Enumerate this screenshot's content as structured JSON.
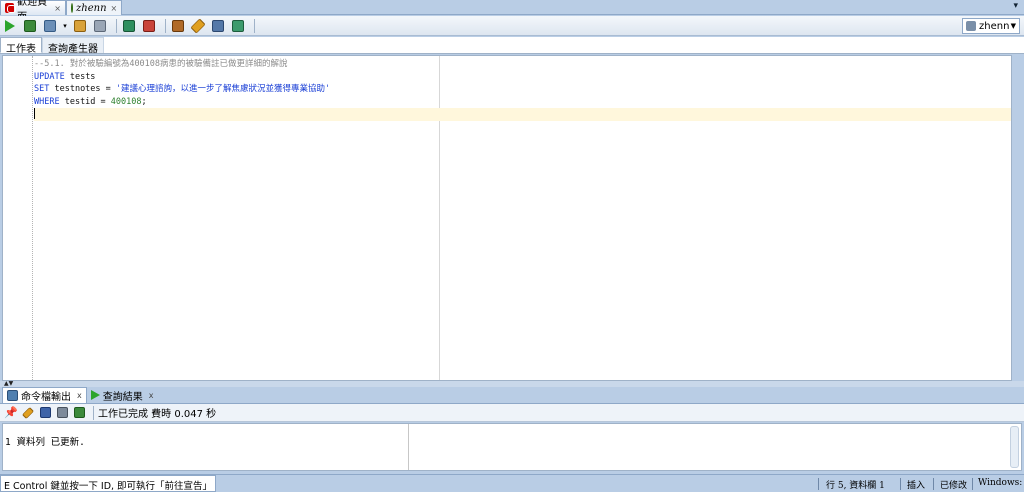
{
  "doc_tabs": [
    {
      "label": "歡迎頁面",
      "close": "×"
    },
    {
      "label": "zhenn",
      "close": "×"
    }
  ],
  "window_menu": "▾",
  "connection": {
    "name": "zhenn"
  },
  "worksheet_tabs": [
    {
      "label": "工作表",
      "active": true
    },
    {
      "label": "查詢產生器",
      "active": false
    }
  ],
  "editor": {
    "lines": [
      {
        "comment": "--5.1. 對於被驗編號為400108病患的被驗備註已做更詳細的解說"
      },
      {
        "kw": "UPDATE",
        "rest": " tests"
      },
      {
        "kw": "SET",
        "mid": " testnotes = ",
        "str": "'建議心理諮詢，以進一步了解焦慮狀況並獲得專業協助'"
      },
      {
        "kw": "WHERE",
        "mid": " testid = ",
        "num": "400108",
        "end": ";"
      }
    ]
  },
  "bottom_tabs": [
    {
      "label": "命令檔輸出",
      "close": "x"
    },
    {
      "label": "查詢結果",
      "close": "x"
    }
  ],
  "bottom_toolbar": {
    "status": "工作已完成 費時 0.047 秒"
  },
  "output": {
    "text": "1 資料列 已更新."
  },
  "statusbar": {
    "message": "E Control 鍵並按一下 ID, 即可執行「前往宣告」",
    "position": "行 5, 資料欄 1",
    "mode": "插入",
    "modified": "已修改",
    "encoding": "Windows: CR"
  },
  "colors": {
    "keyword": "#1a3fd6",
    "comment": "#8c8c8c",
    "number": "#2c7f2c",
    "current_line": "#fff7dc"
  }
}
